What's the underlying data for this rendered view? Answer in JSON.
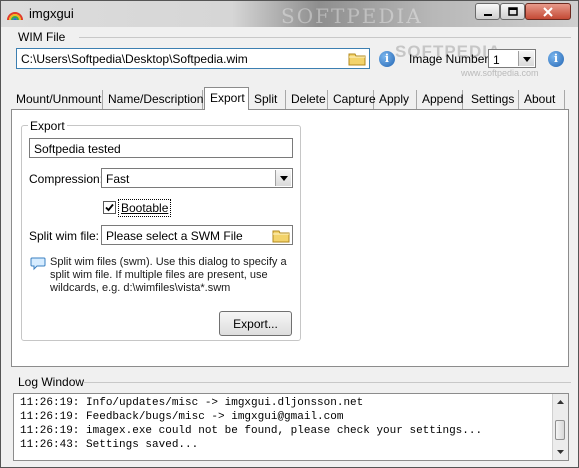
{
  "window": {
    "title": "imgxgui",
    "watermark": "SOFTPEDIA"
  },
  "wim_file": {
    "group_label": "WIM File",
    "path_value": "C:\\Users\\Softpedia\\Desktop\\Softpedia.wim",
    "image_number_label": "Image Number:",
    "image_number_value": "1"
  },
  "overlay": {
    "watermark": "SOFTPEDIA",
    "watermark_url": "www.softpedia.com"
  },
  "tabs": [
    {
      "label": "Mount/Unmount"
    },
    {
      "label": "Name/Description"
    },
    {
      "label": "Export",
      "active": true
    },
    {
      "label": "Split"
    },
    {
      "label": "Delete"
    },
    {
      "label": "Capture"
    },
    {
      "label": "Apply"
    },
    {
      "label": "Append"
    },
    {
      "label": "Settings"
    },
    {
      "label": "About"
    }
  ],
  "export": {
    "group_label": "Export",
    "name_value": "Softpedia tested",
    "compression_label": "Compression:",
    "compression_value": "Fast",
    "bootable_label": "Bootable",
    "bootable_checked": true,
    "split_label": "Split wim file:",
    "split_value": "Please select a SWM File",
    "info_text": "Split wim files (swm). Use this dialog to specify a split wim file. If multiple files are present, use wildcards, e.g. d:\\wimfiles\\vista*.swm",
    "export_button": "Export..."
  },
  "log": {
    "label": "Log Window",
    "lines": [
      "11:26:19: Info/updates/misc -> imgxgui.dljonsson.net",
      "11:26:19: Feedback/bugs/misc -> imgxgui@gmail.com",
      "11:26:19: imagex.exe could not be found, please check your settings...",
      "11:26:43: Settings saved..."
    ]
  },
  "colors": {
    "window_bg": "#f0f0f0",
    "close_button": "#c44a35",
    "info_icon": "#2465b3",
    "focus_border": "#3c7fb1"
  }
}
